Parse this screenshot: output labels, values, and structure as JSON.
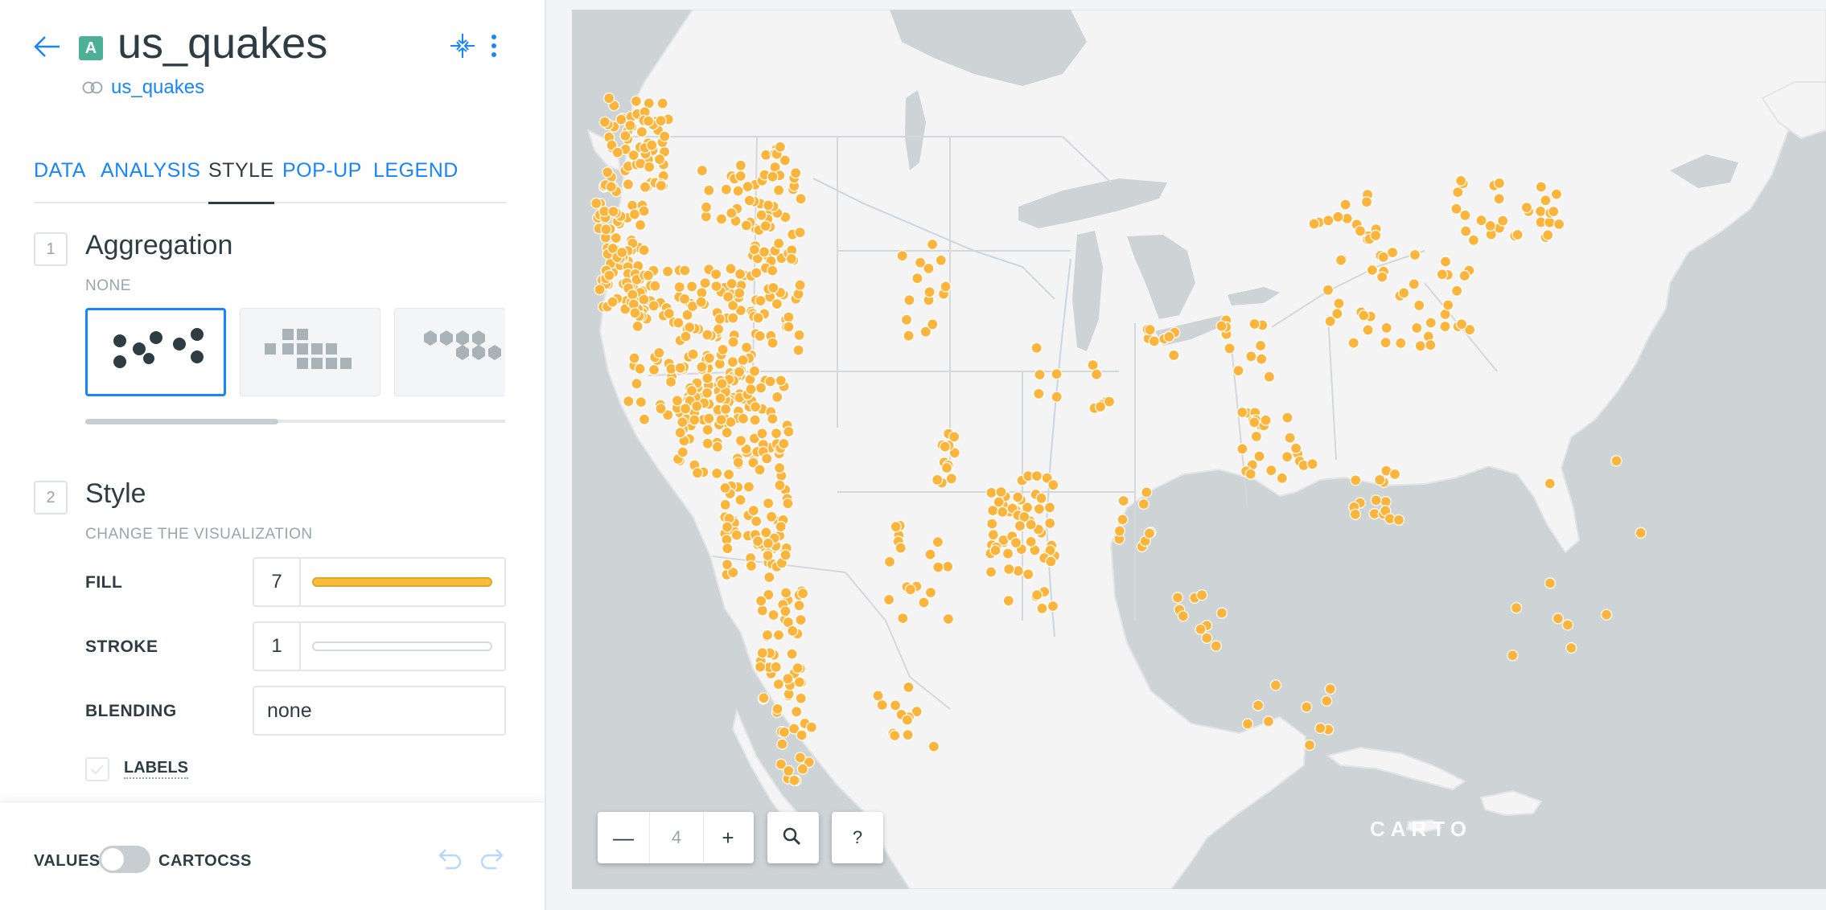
{
  "header": {
    "title": "us_quakes",
    "badge": "A",
    "source": "us_quakes"
  },
  "tabs": [
    {
      "label": "DATA"
    },
    {
      "label": "ANALYSIS"
    },
    {
      "label": "STYLE"
    },
    {
      "label": "POP-UP"
    },
    {
      "label": "LEGEND"
    }
  ],
  "active_tab": "STYLE",
  "aggregation": {
    "step": "1",
    "title": "Aggregation",
    "subtitle": "NONE",
    "selected": "points",
    "options": [
      "points",
      "squares",
      "hexabins"
    ]
  },
  "style": {
    "step": "2",
    "title": "Style",
    "subtitle": "CHANGE THE VISUALIZATION",
    "fill_label": "FILL",
    "fill_value": "7",
    "fill_color": "#f9bd3c",
    "stroke_label": "STROKE",
    "stroke_value": "1",
    "stroke_color": "#ffffff",
    "blending_label": "BLENDING",
    "blending_value": "none",
    "labels_label": "LABELS",
    "labels_checked": false
  },
  "footer": {
    "values_label": "VALUES",
    "cartocss_label": "CARTOCSS",
    "cartocss_enabled": false
  },
  "map": {
    "zoom": "4",
    "zoom_out": "—",
    "zoom_in": "+",
    "help": "?",
    "attribution": "CARTO",
    "point_color": "#fbb53d",
    "land_color": "#f4f4f4",
    "water_color": "#ced3d6"
  },
  "colors": {
    "accent": "#1785fb",
    "text": "#2e3c43",
    "muted": "#9aa5ab"
  }
}
